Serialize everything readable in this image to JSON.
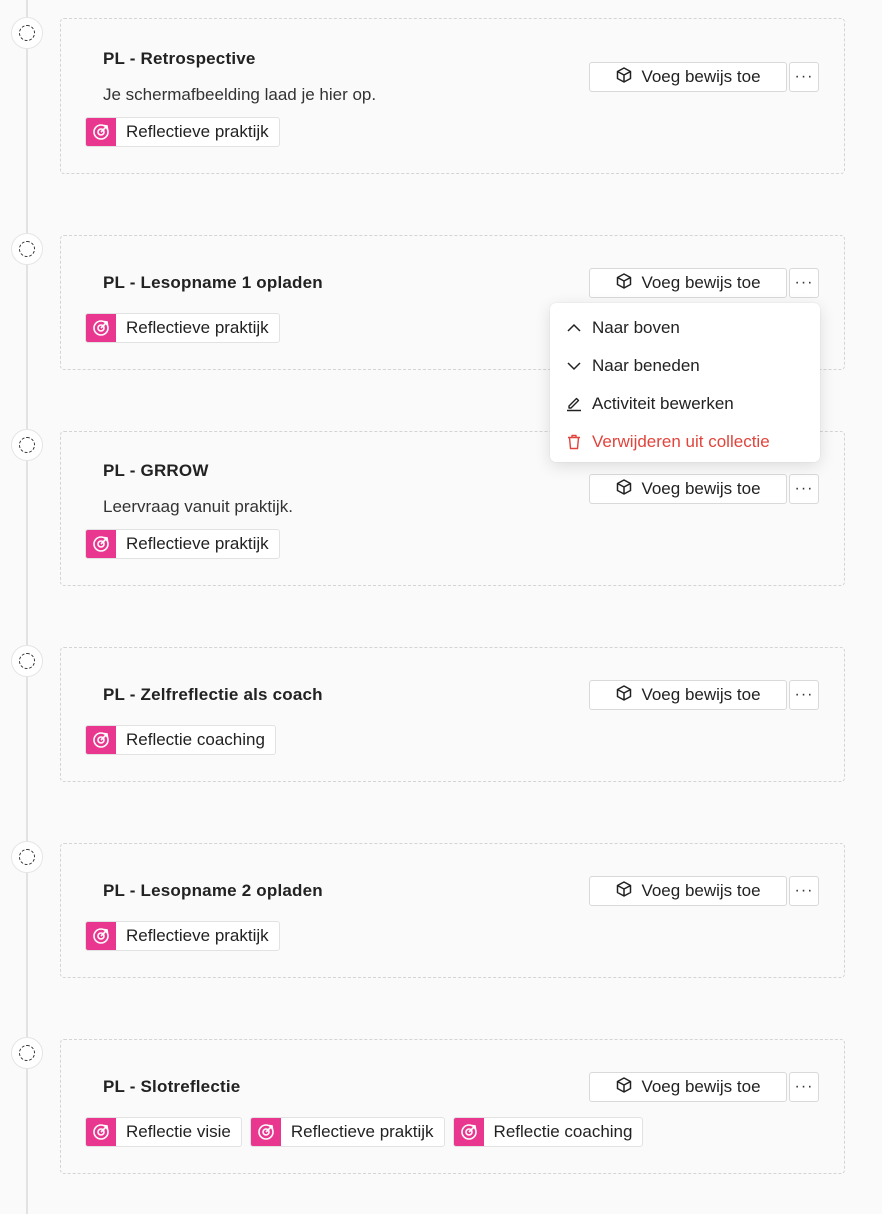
{
  "colors": {
    "tag_accent": "#e9378f",
    "danger": "#e0453d"
  },
  "activities": [
    {
      "title": "PL - Retrospective",
      "description": "Je schermafbeelding laad je hier op.",
      "tags": [
        "Reflectieve praktijk"
      ]
    },
    {
      "title": "PL - Lesopname 1 opladen",
      "description": "",
      "tags": [
        "Reflectieve praktijk"
      ]
    },
    {
      "title": "PL - GRROW",
      "description": "Leervraag vanuit praktijk.",
      "tags": [
        "Reflectieve praktijk"
      ]
    },
    {
      "title": "PL - Zelfreflectie als coach",
      "description": "",
      "tags": [
        "Reflectie coaching"
      ]
    },
    {
      "title": "PL - Lesopname 2 opladen",
      "description": "",
      "tags": [
        "Reflectieve praktijk"
      ]
    },
    {
      "title": "PL - Slotreflectie",
      "description": "",
      "tags": [
        "Reflectie visie",
        "Reflectieve praktijk",
        "Reflectie coaching"
      ]
    }
  ],
  "add_evidence_label": "Voeg bewijs toe",
  "more_label": "···",
  "menu": {
    "items": [
      {
        "label": "Naar boven",
        "icon": "chevron-up-icon"
      },
      {
        "label": "Naar beneden",
        "icon": "chevron-down-icon"
      },
      {
        "label": "Activiteit bewerken",
        "icon": "pencil-icon"
      },
      {
        "label": "Verwijderen uit collectie",
        "icon": "trash-icon"
      }
    ]
  }
}
